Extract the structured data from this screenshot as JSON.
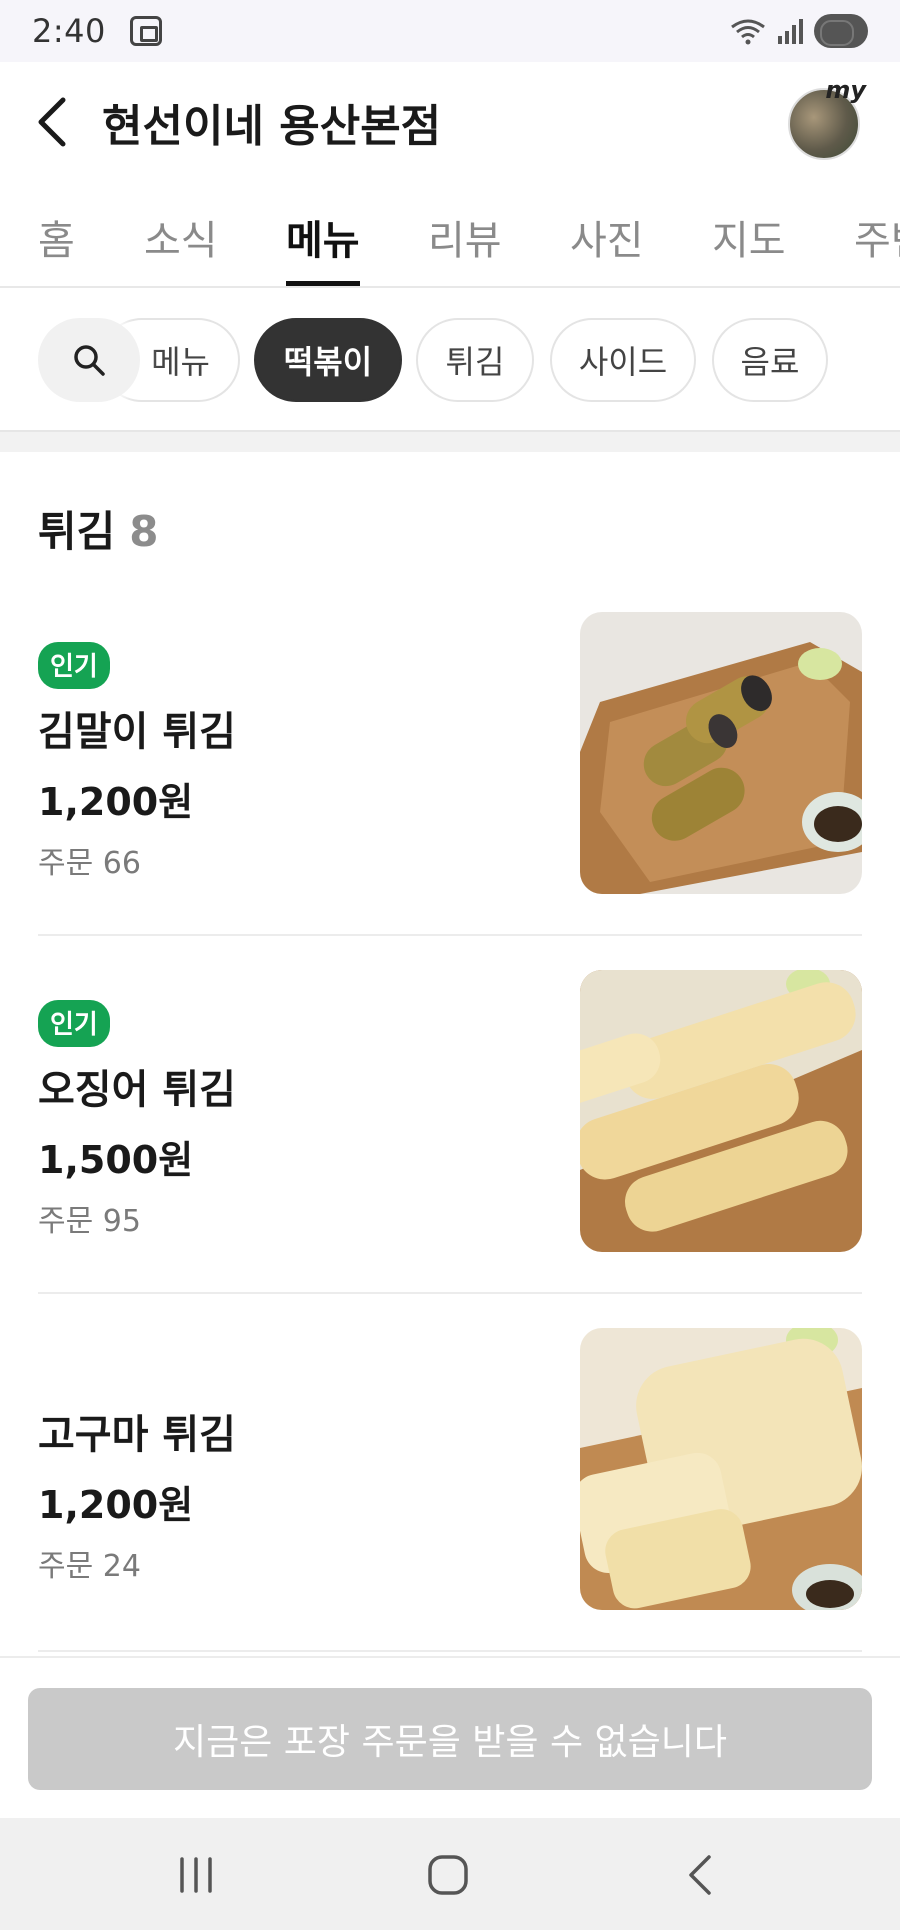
{
  "status_bar": {
    "time": "2:40",
    "icons": [
      "screenshot-icon",
      "wifi-icon",
      "signal-icon",
      "battery-icon"
    ]
  },
  "header": {
    "store_name": "현선이네 용산본점",
    "back_icon": "chevron-left-icon",
    "my_label": "my"
  },
  "tabs": [
    {
      "label": "홈",
      "active": false
    },
    {
      "label": "소식",
      "active": false
    },
    {
      "label": "메뉴",
      "active": true
    },
    {
      "label": "리뷰",
      "active": false
    },
    {
      "label": "사진",
      "active": false
    },
    {
      "label": "지도",
      "active": false
    },
    {
      "label": "주변",
      "active": false
    }
  ],
  "categories": [
    {
      "label": "메뉴",
      "active": false
    },
    {
      "label": "떡볶이",
      "active": true
    },
    {
      "label": "튀김",
      "active": false
    },
    {
      "label": "사이드",
      "active": false
    },
    {
      "label": "음료",
      "active": false
    }
  ],
  "section": {
    "title": "튀김",
    "count": "8"
  },
  "menu_items": [
    {
      "badge": "인기",
      "name": "김말이 튀김",
      "price": "1,200원",
      "orders": "주문 66"
    },
    {
      "badge": "인기",
      "name": "오징어 튀김",
      "price": "1,500원",
      "orders": "주문 95"
    },
    {
      "badge": "",
      "name": "고구마 튀김",
      "price": "1,200원",
      "orders": "주문 24"
    }
  ],
  "cta": {
    "label": "지금은 포장 주문을 받을 수 없습니다",
    "enabled": false
  },
  "colors": {
    "badge_green": "#15a353",
    "active_chip": "#333333",
    "cta_disabled": "#c9c9c9"
  }
}
